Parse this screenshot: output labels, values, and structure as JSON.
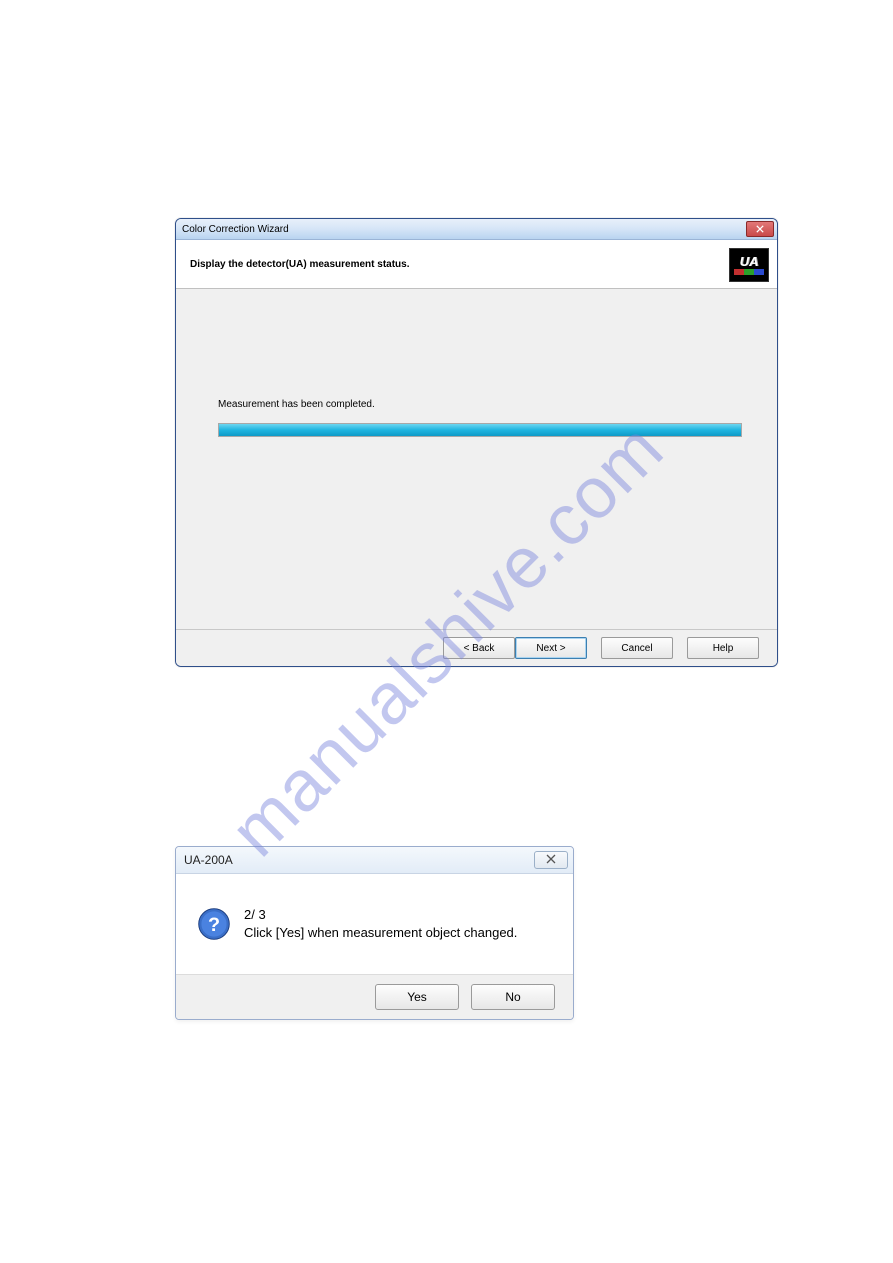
{
  "watermark": "manualshive.com",
  "wizard": {
    "title": "Color Correction Wizard",
    "header_text": "Display the detector(UA) measurement status.",
    "logo_text": "UA",
    "logo_colors": {
      "r": "#c23030",
      "g": "#2aa02a",
      "b": "#2a4ad0"
    },
    "status_text": "Measurement has been completed.",
    "progress_percent": 100,
    "buttons": {
      "back": "< Back",
      "next": "Next >",
      "cancel": "Cancel",
      "help": "Help"
    }
  },
  "msgbox": {
    "title": "UA-200A",
    "counter": "2/ 3",
    "message": "Click [Yes] when measurement object changed.",
    "buttons": {
      "yes": "Yes",
      "no": "No"
    }
  }
}
